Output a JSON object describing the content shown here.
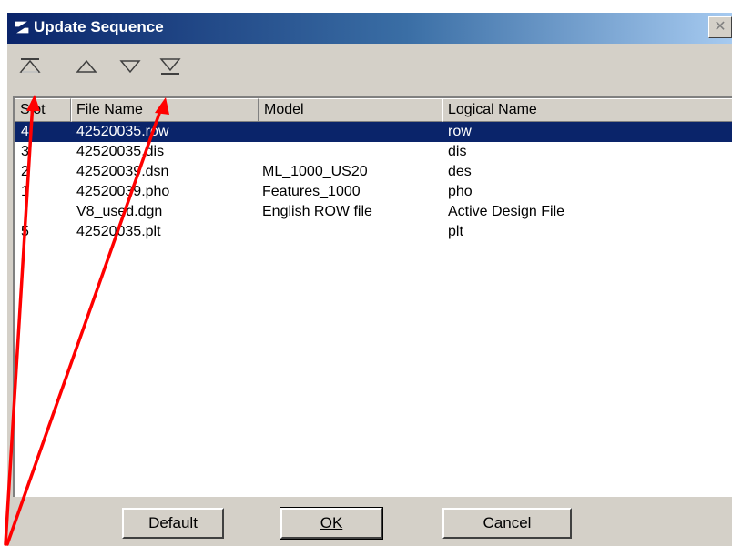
{
  "window": {
    "title": "Update Sequence",
    "close_label": "✕"
  },
  "toolbar": {
    "buttons": [
      {
        "icon": "move-to-top-icon"
      },
      {
        "icon": "move-up-icon"
      },
      {
        "icon": "move-down-icon"
      },
      {
        "icon": "move-to-bottom-icon"
      }
    ]
  },
  "list": {
    "columns": [
      "Slot",
      "File Name",
      "Model",
      "Logical Name"
    ],
    "rows": [
      {
        "slot": "4",
        "file": "42520035.row",
        "model": "",
        "logical": "row",
        "selected": true
      },
      {
        "slot": "3",
        "file": "42520035.dis",
        "model": "",
        "logical": "dis",
        "selected": false
      },
      {
        "slot": "2",
        "file": "42520039.dsn",
        "model": "ML_1000_US20",
        "logical": "des",
        "selected": false
      },
      {
        "slot": "1",
        "file": "42520039.pho",
        "model": "Features_1000",
        "logical": "pho",
        "selected": false
      },
      {
        "slot": "",
        "file": "V8_used.dgn",
        "model": "English ROW file",
        "logical": "Active Design File",
        "selected": false
      },
      {
        "slot": "5",
        "file": "42520035.plt",
        "model": "",
        "logical": "plt",
        "selected": false
      }
    ]
  },
  "buttons": {
    "default_label": "Default",
    "ok_label": "OK",
    "cancel_label": "Cancel"
  },
  "colors": {
    "selection": "#0a246a",
    "annotation_arrow": "#ff0000"
  }
}
